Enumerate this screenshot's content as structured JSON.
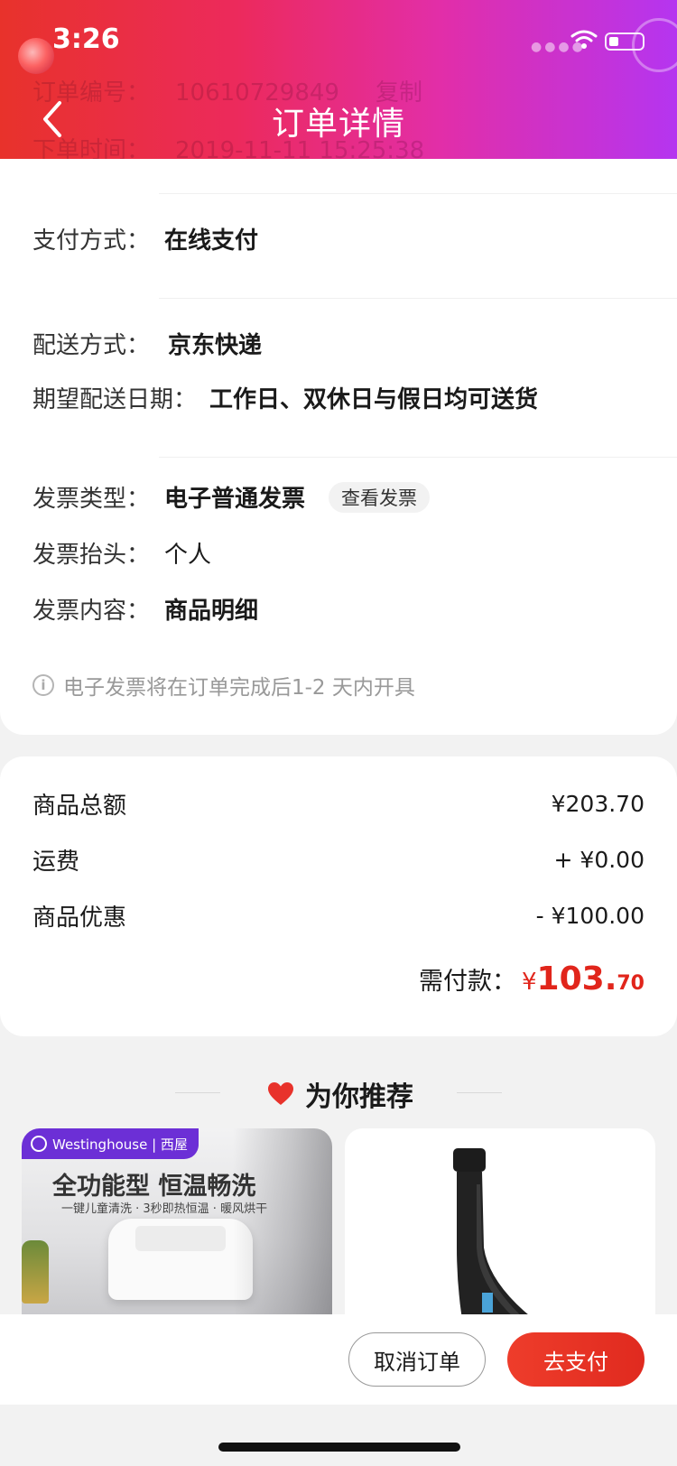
{
  "status_bar": {
    "time": "3:26"
  },
  "header": {
    "title": "订单详情",
    "ghost_rows": [
      {
        "label": "订单编号：",
        "value": "10610729849",
        "action": "复制"
      },
      {
        "label": "下单时间：",
        "value": "2019-11-11 15:25:38"
      }
    ]
  },
  "info": {
    "payment": {
      "label": "支付方式：",
      "value": "在线支付"
    },
    "delivery": {
      "label": "配送方式：",
      "value": "京东快递"
    },
    "expected_date": {
      "label": "期望配送日期：",
      "value": "工作日、双休日与假日均可送货"
    },
    "invoice_type": {
      "label": "发票类型：",
      "value": "电子普通发票",
      "button": "查看发票"
    },
    "invoice_title": {
      "label": "发票抬头：",
      "value": "个人"
    },
    "invoice_content": {
      "label": "发票内容：",
      "value": "商品明细"
    },
    "note": "电子发票将在订单完成后1-2 天内开具"
  },
  "price": {
    "rows": [
      {
        "label": "商品总额",
        "value": "¥203.70"
      },
      {
        "label": "运费",
        "value": "+ ¥0.00"
      },
      {
        "label": "商品优惠",
        "value": "- ¥100.00"
      }
    ],
    "total_label": "需付款：",
    "total_currency": "¥",
    "total_integer": "103.",
    "total_decimal": "70"
  },
  "recommend": {
    "title": "为你推荐",
    "products": [
      {
        "brand": "Westinghouse | 西屋",
        "headline": "全功能型 恒温畅洗",
        "sub": "一键儿童清洗 · 3秒即热恒温 · 暖风烘干"
      },
      {}
    ]
  },
  "actions": {
    "cancel": "取消订单",
    "pay": "去支付"
  },
  "colors": {
    "accent_red": "#e1251b",
    "brand_purple": "#6c2fd6"
  }
}
